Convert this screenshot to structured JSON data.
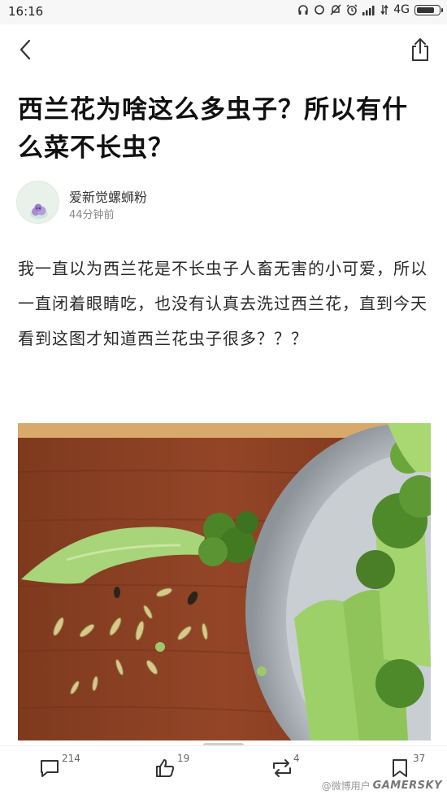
{
  "status_bar": {
    "time": "16:16",
    "network": "4G",
    "battery_level": 0.85,
    "icons": [
      "headphones-icon",
      "sync-icon",
      "do-not-disturb-icon",
      "alarm-icon",
      "signal-icon",
      "data-icon",
      "battery-icon"
    ]
  },
  "nav": {
    "back_icon": "chevron-left-icon",
    "share_icon": "share-icon"
  },
  "post": {
    "title": "西兰花为啥这么多虫子？所以有什么菜不长虫？",
    "author": {
      "name": "爱新觉螺蛳粉",
      "time": "44分钟前"
    },
    "body": "我一直以为西兰花是不长虫子人畜无害的小可爱，所以一直闭着眼睛吃，也没有认真去洗过西兰花，直到今天看到这图才知道西兰花虫子很多？？？"
  },
  "actions": {
    "comments": "214",
    "likes": "19",
    "reposts": "4",
    "bookmarks": "37"
  },
  "watermark": {
    "text": "@微博用户",
    "logo": "GAMERSKY"
  },
  "colors": {
    "accent": "#1a1a1a",
    "muted": "#888888",
    "board": "#8a3f22",
    "broccoli": "#8fc45a"
  }
}
